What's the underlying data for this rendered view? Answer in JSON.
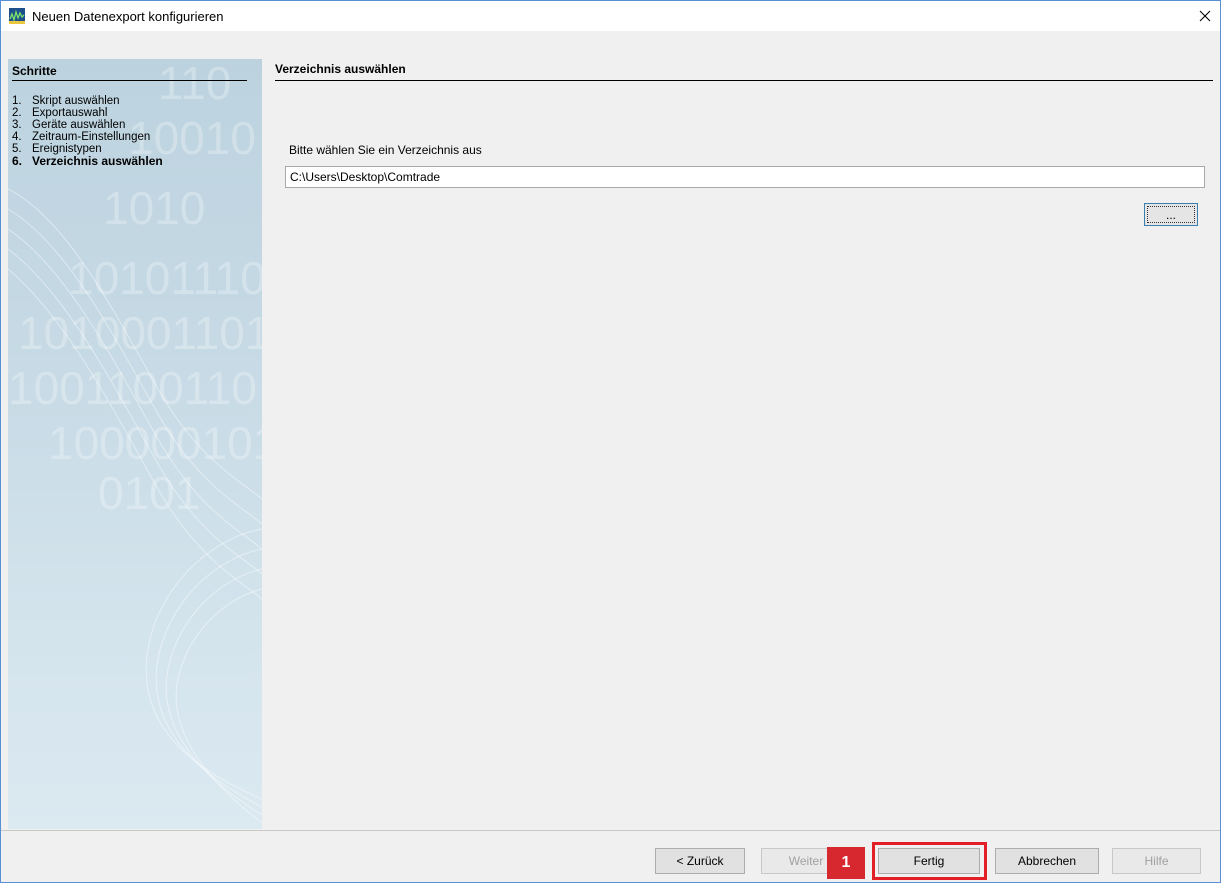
{
  "window": {
    "title": "Neuen Datenexport konfigurieren"
  },
  "sidebar": {
    "header": "Schritte",
    "steps": [
      {
        "num": "1.",
        "label": "Skript auswählen"
      },
      {
        "num": "2.",
        "label": "Exportauswahl"
      },
      {
        "num": "3.",
        "label": "Geräte auswählen"
      },
      {
        "num": "4.",
        "label": "Zeitraum-Einstellungen"
      },
      {
        "num": "5.",
        "label": "Ereignistypen"
      },
      {
        "num": "6.",
        "label": "Verzeichnis auswählen"
      }
    ],
    "active_step": 6
  },
  "main": {
    "section_title": "Verzeichnis auswählen",
    "directory_label": "Bitte wählen Sie ein Verzeichnis aus",
    "directory_value": "C:\\Users\\Desktop\\Comtrade",
    "browse_label": "..."
  },
  "footer": {
    "back_label": "< Zurück",
    "next_label": "Weiter",
    "finish_label": "Fertig",
    "cancel_label": "Abbrechen",
    "help_label": "Hilfe"
  },
  "annotation": {
    "badge": "1",
    "color": "#e21e26"
  }
}
